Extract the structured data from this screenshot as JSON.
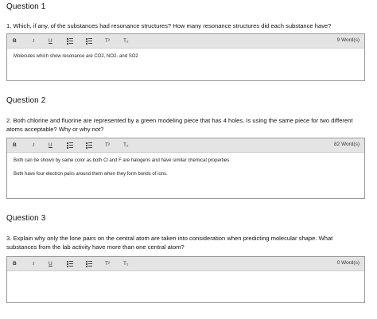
{
  "questions": [
    {
      "title": "Question 1",
      "prompt": "1. Which, if any, of the substances had resonance structures? How many resonance structures did each substance have?",
      "word_count": "9 Word(s)",
      "answer": [
        "Molecules which show resonance are CO2, NO2- and SO2"
      ]
    },
    {
      "title": "Question 2",
      "prompt": "2. Both chlorine and fluorine are represented by a green modeling piece that has 4 holes. Is using the same piece for two different atoms acceptable? Why or why not?",
      "word_count": "82 Word(s)",
      "answer": [
        "Both can be shown by same color as both Cl and F are halogens and have similar chemical properties.",
        "Both have four electron pairs around them when they form bonds of ions."
      ]
    },
    {
      "title": "Question 3",
      "prompt": "3. Explain why only the lone pairs on the central atom are taken into consideration when predicting molecular shape.  What substances from the lab activity have more than one central atom?",
      "word_count": "0 Word(s)",
      "answer": []
    }
  ],
  "toolbar": {
    "bold": "B",
    "italic": "I",
    "underline": "U",
    "superscript": "T²",
    "subscript": "T₂"
  },
  "icons": {
    "bullet_list": "bullet-list-icon",
    "numbered_list": "numbered-list-icon"
  }
}
